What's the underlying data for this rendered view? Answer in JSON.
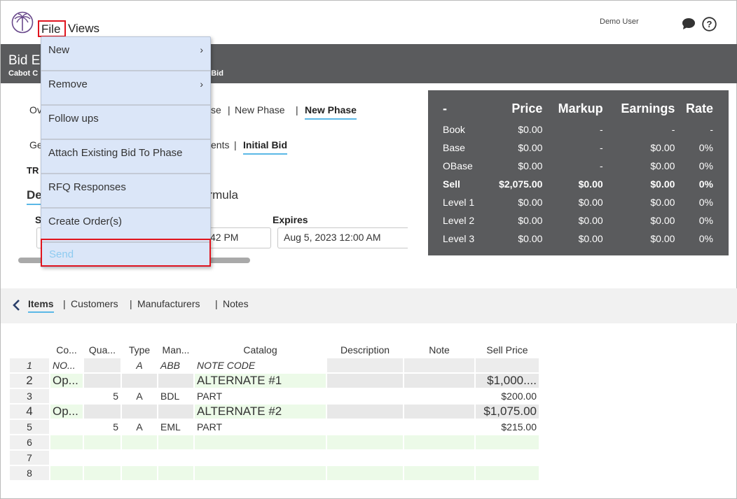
{
  "app": {
    "menu": {
      "file": "File",
      "views": "Views"
    },
    "user": "Demo User"
  },
  "header": {
    "title_partial": "Bid E",
    "subtitle_left_partial": "Cabot C",
    "subtitle_right_partial": "al Bid"
  },
  "phase_tabs": {
    "row1": [
      {
        "label": "Ov"
      },
      {
        "label": "se"
      },
      {
        "label": "New Phase"
      },
      {
        "label": "New Phase",
        "active": true
      }
    ],
    "row2": [
      {
        "label": "Ge"
      },
      {
        "label": "ents"
      },
      {
        "label": "Initial Bid",
        "active": true
      }
    ]
  },
  "form": {
    "tr_label_partial": "TR",
    "de_tab_partial": "De",
    "s_label_partial": "S",
    "formula_label_partial": "ormula",
    "start_value_partial": "42 PM",
    "expires_label": "Expires",
    "expires_value": "Aug 5, 2023 12:00 AM"
  },
  "file_menu": {
    "items": [
      {
        "label": "New",
        "submenu": true
      },
      {
        "label": "Remove",
        "submenu": true
      },
      {
        "label": "Follow ups"
      },
      {
        "label": "Attach Existing Bid To Phase"
      },
      {
        "label": "RFQ Responses"
      },
      {
        "label": "Create Order(s)"
      },
      {
        "label": "Send",
        "disabled": true
      }
    ]
  },
  "summary": {
    "headers": [
      "-",
      "Price",
      "Markup",
      "Earnings",
      "Rate"
    ],
    "rows": [
      {
        "label": "Book",
        "price": "$0.00",
        "markup": "-",
        "earnings": "-",
        "rate": "-"
      },
      {
        "label": "Base",
        "price": "$0.00",
        "markup": "-",
        "earnings": "$0.00",
        "rate": "0%"
      },
      {
        "label": "OBase",
        "price": "$0.00",
        "markup": "-",
        "earnings": "$0.00",
        "rate": "0%"
      },
      {
        "label": "Sell",
        "price": "$2,075.00",
        "markup": "$0.00",
        "earnings": "$0.00",
        "rate": "0%",
        "bold": true
      },
      {
        "label": "Level 1",
        "price": "$0.00",
        "markup": "$0.00",
        "earnings": "$0.00",
        "rate": "0%"
      },
      {
        "label": "Level 2",
        "price": "$0.00",
        "markup": "$0.00",
        "earnings": "$0.00",
        "rate": "0%"
      },
      {
        "label": "Level 3",
        "price": "$0.00",
        "markup": "$0.00",
        "earnings": "$0.00",
        "rate": "0%"
      }
    ]
  },
  "items_nav": {
    "tabs": [
      "Items",
      "Customers",
      "Manufacturers",
      "Notes"
    ],
    "separator": "|"
  },
  "grid": {
    "headers": [
      "Co...",
      "Qua...",
      "Type",
      "Man...",
      "Catalog",
      "Description",
      "Note",
      "Sell Price"
    ],
    "rows": [
      {
        "n": "1",
        "code": "NO...",
        "qty": "",
        "type": "A",
        "man": "ABB",
        "catalog": "NOTE CODE",
        "desc": "",
        "note": "",
        "sell": ""
      },
      {
        "n": "2",
        "code": "Op...",
        "qty": "",
        "type": "",
        "man": "",
        "catalog": "ALTERNATE #1",
        "desc": "",
        "note": "",
        "sell": "$1,000...."
      },
      {
        "n": "3",
        "code": "",
        "qty": "5",
        "type": "A",
        "man": "BDL",
        "catalog": "PART",
        "desc": "",
        "note": "",
        "sell": "$200.00"
      },
      {
        "n": "4",
        "code": "Op...",
        "qty": "",
        "type": "",
        "man": "",
        "catalog": "ALTERNATE #2",
        "desc": "",
        "note": "",
        "sell": "$1,075.00"
      },
      {
        "n": "5",
        "code": "",
        "qty": "5",
        "type": "A",
        "man": "EML",
        "catalog": "PART",
        "desc": "",
        "note": "",
        "sell": "$215.00"
      },
      {
        "n": "6",
        "code": "",
        "qty": "",
        "type": "",
        "man": "",
        "catalog": "",
        "desc": "",
        "note": "",
        "sell": ""
      },
      {
        "n": "7",
        "code": "",
        "qty": "",
        "type": "",
        "man": "",
        "catalog": "",
        "desc": "",
        "note": "",
        "sell": ""
      },
      {
        "n": "8",
        "code": "",
        "qty": "",
        "type": "",
        "man": "",
        "catalog": "",
        "desc": "",
        "note": "",
        "sell": ""
      }
    ]
  }
}
